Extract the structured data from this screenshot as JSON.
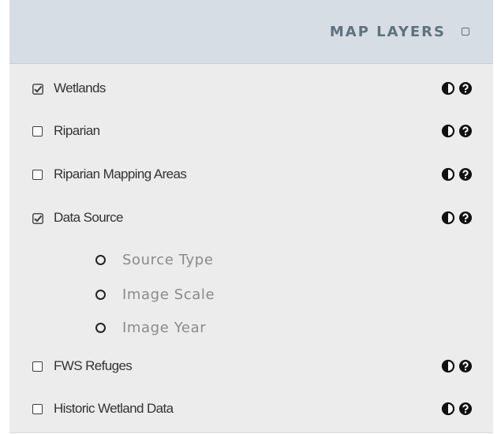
{
  "panel": {
    "title": "MAP LAYERS",
    "collapse_icon": "square-icon"
  },
  "layers": [
    {
      "label": "Wetlands",
      "checked": true
    },
    {
      "label": "Riparian",
      "checked": false
    },
    {
      "label": "Riparian Mapping Areas",
      "checked": false
    },
    {
      "label": "Data Source",
      "checked": true
    },
    {
      "label": "FWS Refuges",
      "checked": false
    },
    {
      "label": "Historic Wetland Data",
      "checked": false
    }
  ],
  "data_source_options": [
    {
      "label": "Source Type",
      "selected": false
    },
    {
      "label": "Image Scale",
      "selected": false
    },
    {
      "label": "Image Year",
      "selected": false
    }
  ],
  "row_icons": [
    "contrast-icon",
    "info-circle-icon"
  ],
  "colors": {
    "header_bg": "#d7dde4",
    "header_text": "#5e7280",
    "panel_bg": "#ececec",
    "label_text": "#333333",
    "sublabel_text": "#8a8a8a"
  }
}
